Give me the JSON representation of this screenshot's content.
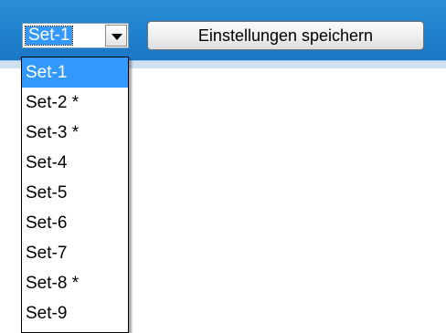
{
  "set_select": {
    "value": "Set-1",
    "arrow_icon": "chevron-down-icon",
    "options": [
      {
        "label": "Set-1",
        "selected": true
      },
      {
        "label": "Set-2 *",
        "selected": false
      },
      {
        "label": "Set-3 *",
        "selected": false
      },
      {
        "label": "Set-4",
        "selected": false
      },
      {
        "label": "Set-5",
        "selected": false
      },
      {
        "label": "Set-6",
        "selected": false
      },
      {
        "label": "Set-7",
        "selected": false
      },
      {
        "label": "Set-8 *",
        "selected": false
      },
      {
        "label": "Set-9",
        "selected": false
      }
    ]
  },
  "toolbar": {
    "save_label": "Einstellungen speichern"
  },
  "colors": {
    "header": "#1e7fcc",
    "selection": "#3399ff"
  }
}
